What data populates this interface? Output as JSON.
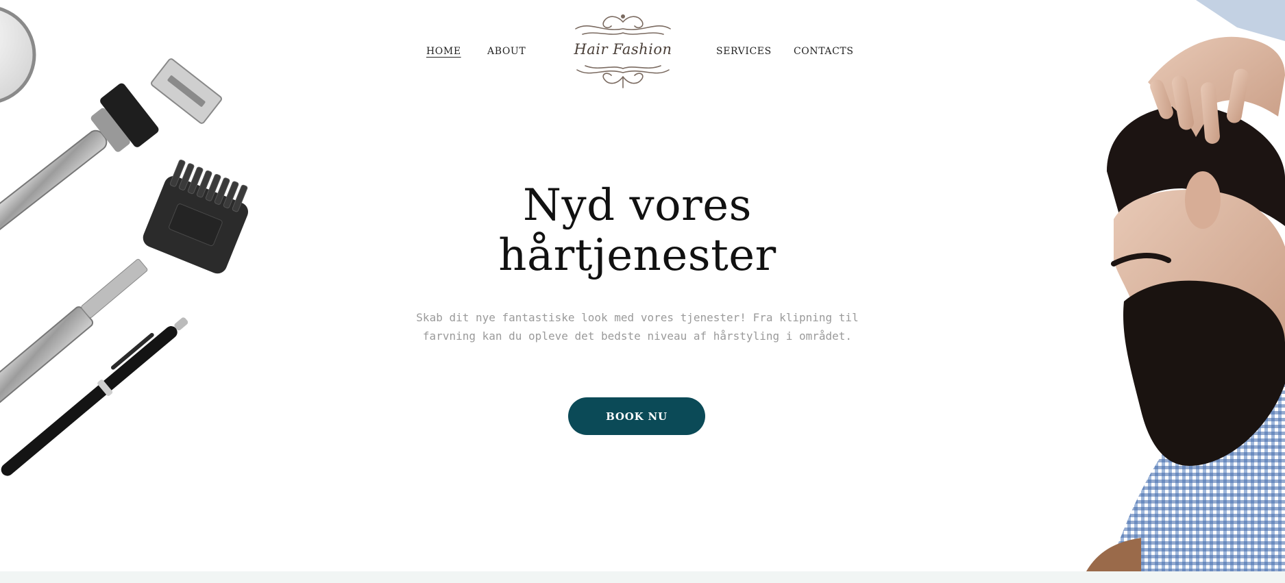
{
  "nav": {
    "items": [
      {
        "label": "HOME",
        "active": true
      },
      {
        "label": "ABOUT",
        "active": false
      },
      {
        "label": "SERVICES",
        "active": false
      },
      {
        "label": "CONTACTS",
        "active": false
      }
    ],
    "logo_text": "Hair Fashion"
  },
  "hero": {
    "title_line1": "Nyd vores",
    "title_line2": "hårtjenester",
    "subtitle": "Skab dit nye fantastiske look med vores tjenester! Fra klipning til farvning kan du opleve det bedste niveau af hårstyling i området.",
    "cta_label": "BOOK NU"
  },
  "colors": {
    "accent": "#0b4a57",
    "text": "#111111",
    "muted": "#9a9a9a",
    "logo": "#4a3f38",
    "bottom_band": "#f1f5f4"
  },
  "icons": [
    "barber-tools-image",
    "bearded-man-image",
    "ornament-logo"
  ]
}
